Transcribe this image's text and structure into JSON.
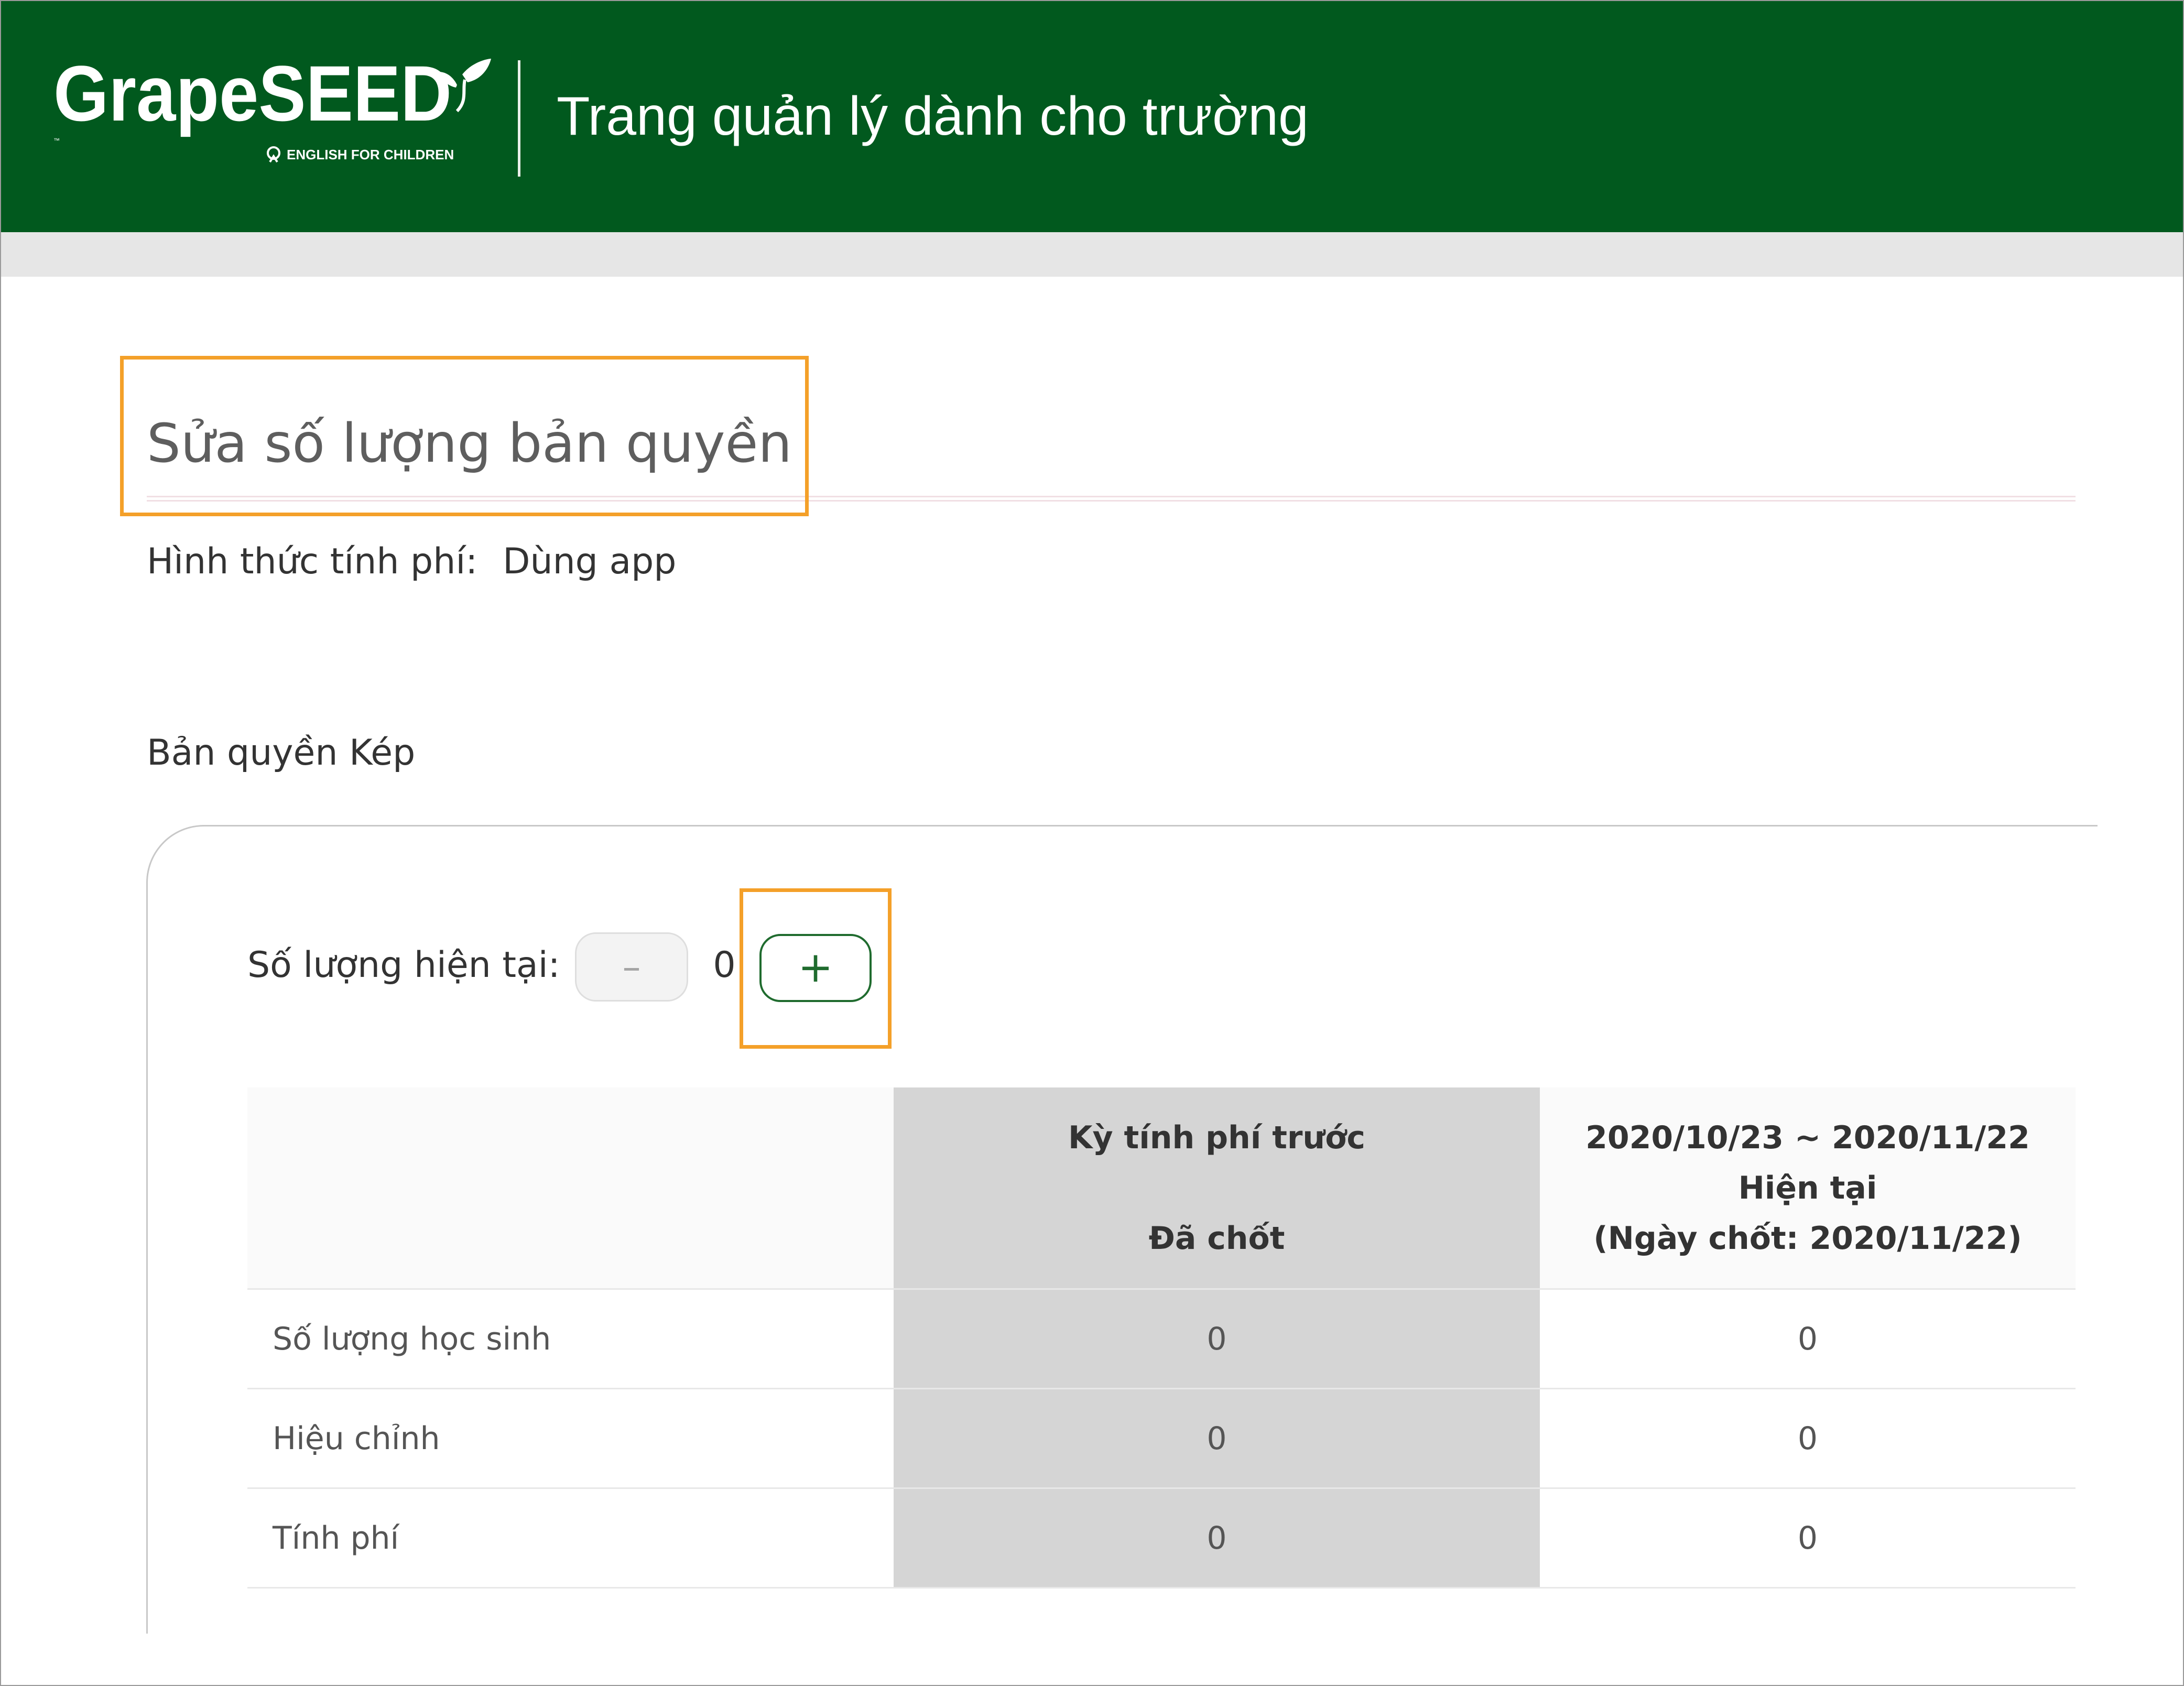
{
  "header": {
    "app_title": "Trang quản lý dành cho trường",
    "logo": {
      "wordmark": "GrapeSEED",
      "tagline": "ENGLISH FOR CHILDREN",
      "icon": "grapeseed-leaf-icon"
    }
  },
  "page": {
    "title": "Sửa số lượng bản quyền",
    "billing_label": "Hình thức tính phí:",
    "billing_value": "Dùng app",
    "section_label": "Bản quyền Kép"
  },
  "quantity": {
    "label": "Số lượng hiện tại:",
    "value": "0",
    "minus_label": "–",
    "plus_label": "+"
  },
  "table": {
    "columns": [
      {
        "lines": []
      },
      {
        "lines": [
          "Kỳ tính phí trước",
          "",
          "Đã chốt"
        ]
      },
      {
        "lines": [
          "2020/10/23 ~ 2020/11/22",
          "Hiện tại",
          "(Ngày chốt: 2020/11/22)"
        ]
      }
    ],
    "rows": [
      {
        "label": "Số lượng học sinh",
        "previous": "0",
        "current": "0"
      },
      {
        "label": "Hiệu chỉnh",
        "previous": "0",
        "current": "0"
      },
      {
        "label": "Tính phí",
        "previous": "0",
        "current": "0"
      }
    ]
  },
  "colors": {
    "header_bg": "#01591e",
    "highlight": "#f4a029",
    "accent_green": "#1f6b2e",
    "shaded_column": "#d5d5d5"
  }
}
